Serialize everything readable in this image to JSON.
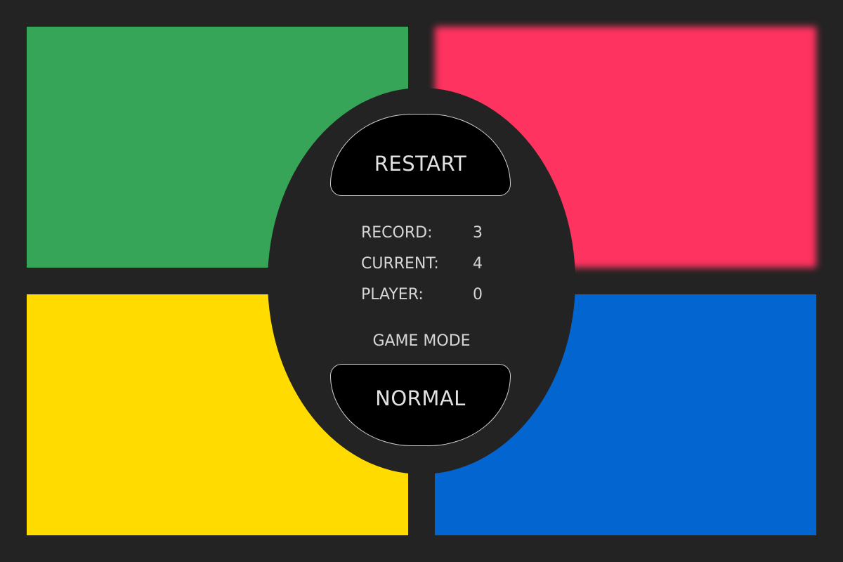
{
  "pads": {
    "green": {
      "color": "#37a558"
    },
    "red": {
      "color": "#ff335f",
      "state": "highlighted"
    },
    "yellow": {
      "color": "#ffdb00"
    },
    "blue": {
      "color": "#0365d0"
    }
  },
  "controls": {
    "restart_label": "RESTART",
    "mode_label": "NORMAL"
  },
  "stats": [
    {
      "label": "RECORD:",
      "value": "3"
    },
    {
      "label": "CURRENT:",
      "value": "4"
    },
    {
      "label": "PLAYER:",
      "value": "0"
    }
  ],
  "game_mode_title": "GAME MODE",
  "colors": {
    "background": "#232323",
    "button_fill": "#000000",
    "button_border": "#cfcfcf",
    "text": "#d6d6d6"
  }
}
